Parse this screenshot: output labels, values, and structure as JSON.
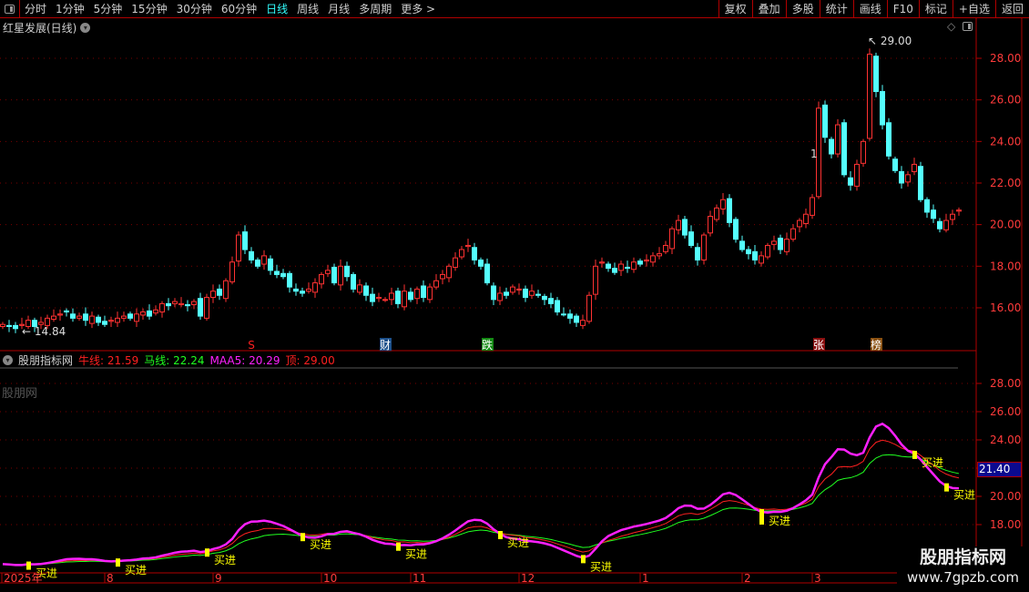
{
  "toolbar": {
    "periods": [
      "分时",
      "1分钟",
      "5分钟",
      "15分钟",
      "30分钟",
      "60分钟",
      "日线",
      "周线",
      "月线",
      "多周期",
      "更多 >"
    ],
    "active": "日线",
    "buttons": [
      "复权",
      "叠加",
      "多股",
      "统计",
      "画线",
      "F10",
      "标记",
      "+自选",
      "返回"
    ]
  },
  "main": {
    "title": "红星发展(日线)",
    "high_label": "29.00",
    "low_label": "14.84",
    "marker_1": "1",
    "y_ticks": [
      "28.00",
      "26.00",
      "24.00",
      "22.00",
      "20.00",
      "18.00",
      "16.00"
    ],
    "events": [
      {
        "text": "S",
        "color": "#ff2020",
        "bg": "transparent",
        "idx": 39
      },
      {
        "text": "财",
        "color": "#fff",
        "bg": "#1c4f8a",
        "idx": 60
      },
      {
        "text": "跌",
        "color": "#fff",
        "bg": "#138a13",
        "idx": 76
      },
      {
        "text": "张",
        "color": "#fff",
        "bg": "#8a1010",
        "idx": 128
      },
      {
        "text": "榜",
        "color": "#fff",
        "bg": "#8a5010",
        "idx": 137
      }
    ]
  },
  "indicator": {
    "name": "股朋指标网",
    "bull_label": "牛线:",
    "bull_value": "21.59",
    "horse_label": "马线:",
    "horse_value": "22.24",
    "maa5_label": "MAA5:",
    "maa5_value": "20.29",
    "top_label": "顶:",
    "top_value": "29.00",
    "watermark": "股朋网",
    "current_value": "21.40",
    "y_ticks": [
      "28.00",
      "26.00",
      "24.00",
      "22.00",
      "20.00",
      "18.00"
    ],
    "buy_label": "买进",
    "buy_idx": [
      4,
      18,
      32,
      47,
      62,
      78,
      91,
      119,
      143,
      148
    ],
    "colors": {
      "bull": "#ff2020",
      "horse": "#20ff20",
      "maa5": "#ff20ff",
      "top": "#ff2020",
      "signal": "#ffff00"
    }
  },
  "date_axis": {
    "labels": [
      {
        "t": "2025年",
        "i": 0
      },
      {
        "t": "8",
        "i": 16
      },
      {
        "t": "9",
        "i": 33
      },
      {
        "t": "10",
        "i": 50
      },
      {
        "t": "11",
        "i": 64
      },
      {
        "t": "12",
        "i": 81
      },
      {
        "t": "1",
        "i": 100
      },
      {
        "t": "2",
        "i": 116
      },
      {
        "t": "3",
        "i": 127
      }
    ]
  },
  "watermark": {
    "line1": "股朋指标网",
    "line2": "www.7gpzb.com"
  },
  "chart_data": {
    "type": "candlestick",
    "title": "红星发展(日线)",
    "ylim": [
      14.5,
      29.5
    ],
    "closes": [
      15.2,
      15.1,
      15.0,
      15.2,
      15.4,
      15.1,
      15.3,
      15.5,
      15.6,
      15.7,
      15.8,
      15.5,
      15.6,
      15.4,
      15.6,
      15.3,
      15.2,
      15.4,
      15.5,
      15.6,
      15.5,
      15.7,
      15.8,
      15.6,
      15.9,
      16.2,
      16.1,
      16.3,
      16.2,
      16.1,
      16.3,
      15.6,
      16.5,
      16.8,
      16.6,
      17.3,
      18.2,
      19.5,
      18.8,
      18.3,
      18.0,
      18.5,
      17.8,
      17.6,
      17.5,
      17.0,
      16.8,
      16.7,
      16.9,
      17.2,
      17.6,
      17.8,
      17.2,
      18.0,
      17.5,
      16.9,
      17.1,
      16.6,
      16.3,
      16.5,
      16.4,
      16.7,
      16.2,
      16.8,
      16.4,
      16.9,
      16.5,
      17.0,
      17.3,
      17.6,
      18.0,
      18.4,
      18.8,
      19.0,
      18.3,
      18.0,
      17.2,
      16.4,
      16.7,
      16.6,
      17.0,
      16.9,
      16.5,
      16.8,
      16.6,
      16.4,
      16.2,
      15.8,
      15.7,
      15.5,
      15.3,
      15.4,
      16.6,
      18.0,
      18.2,
      17.9,
      17.7,
      18.1,
      17.9,
      18.2,
      18.1,
      18.3,
      18.5,
      18.6,
      19.0,
      19.8,
      20.2,
      19.5,
      19.0,
      18.3,
      19.5,
      20.4,
      20.8,
      21.2,
      20.1,
      19.3,
      18.8,
      18.6,
      18.3,
      18.5,
      19.0,
      19.2,
      18.8,
      19.3,
      19.8,
      20.2,
      20.5,
      21.3,
      25.6,
      24.2,
      23.4,
      24.8,
      22.4,
      21.9,
      22.9,
      24.0,
      28.2,
      26.4,
      24.8,
      23.3,
      22.6,
      22.0,
      22.4,
      22.9,
      21.2,
      20.6,
      20.3,
      19.8,
      20.2,
      20.5,
      20.7
    ]
  }
}
